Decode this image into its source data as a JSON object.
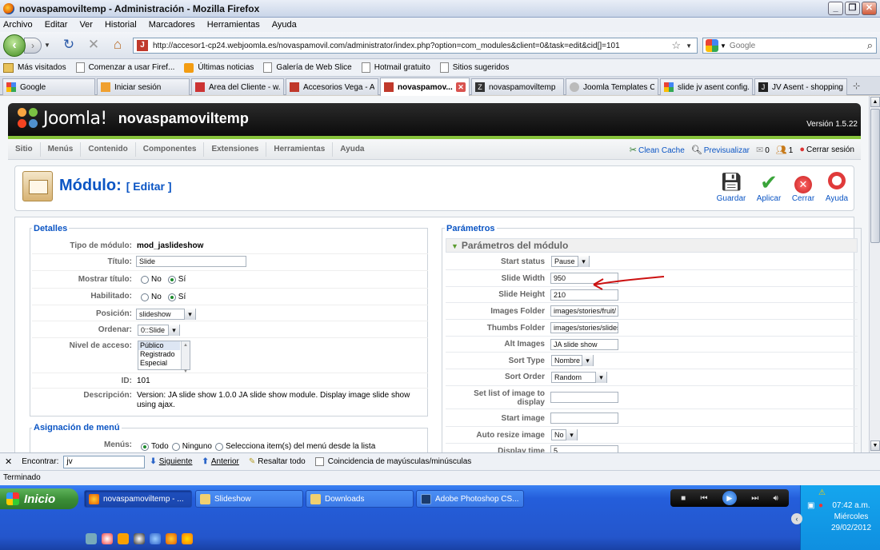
{
  "window": {
    "title": "novaspamoviltemp - Administración - Mozilla Firefox"
  },
  "menubar": [
    "Archivo",
    "Editar",
    "Ver",
    "Historial",
    "Marcadores",
    "Herramientas",
    "Ayuda"
  ],
  "url": "http://accesor1-cp24.webjoomla.es/novaspamovil.com/administrator/index.php?option=com_modules&client=0&task=edit&cid[]=101",
  "search_placeholder": "Google",
  "bookmarks": [
    "Más visitados",
    "Comenzar a usar Firef...",
    "Últimas noticias",
    "Galería de Web Slice",
    "Hotmail gratuito",
    "Sitios sugeridos"
  ],
  "tabs": [
    "Google",
    "Iniciar sesión",
    "Área del Cliente - w...",
    "Accesorios Vega - A...",
    "novaspamov...",
    "novaspamoviltemp",
    "Joomla Templates C...",
    "slide jv asent config...",
    "JV Asent - shopping..."
  ],
  "joomla": {
    "brand": "Joomla!",
    "site": "novaspamoviltemp",
    "version": "Versión 1.5.22",
    "menu": [
      "Sitio",
      "Menús",
      "Contenido",
      "Componentes",
      "Extensiones",
      "Herramientas",
      "Ayuda"
    ],
    "status": {
      "clean_cache": "Clean Cache",
      "preview": "Previsualizar",
      "messages": "0",
      "users": "1",
      "logout": "Cerrar sesión"
    },
    "page_title": "Módulo:",
    "page_subtitle": "[ Editar ]",
    "toolbar": {
      "save": "Guardar",
      "apply": "Aplicar",
      "close": "Cerrar",
      "help": "Ayuda"
    }
  },
  "details": {
    "legend": "Detalles",
    "type_label": "Tipo de módulo:",
    "type_value": "mod_jaslideshow",
    "title_label": "Título:",
    "title_value": "Slide",
    "show_title_label": "Mostrar título:",
    "enabled_label": "Habilitado:",
    "no": "No",
    "yes": "Sí",
    "position_label": "Posición:",
    "position_value": "slideshow",
    "order_label": "Ordenar:",
    "order_value": "0::Slide",
    "access_label": "Nivel de acceso:",
    "access_options": [
      "Público",
      "Registrado",
      "Especial"
    ],
    "id_label": "ID:",
    "id_value": "101",
    "desc_label": "Descripción:",
    "desc_value": "Version: JA slide show 1.0.0 JA slide show module. Display image slide show using ajax."
  },
  "menu_assign": {
    "legend": "Asignación de menú",
    "menus_label": "Menús:",
    "options": [
      "Todo",
      "Ninguno",
      "Selecciona item(s) del menú desde la lista"
    ]
  },
  "params": {
    "legend": "Parámetros",
    "section": "Parámetros del módulo",
    "rows": [
      {
        "label": "Start status",
        "value": "Pause"
      },
      {
        "label": "Slide Width",
        "value": "950"
      },
      {
        "label": "Slide Height",
        "value": "210"
      },
      {
        "label": "Images Folder",
        "value": "images/stories/fruit/"
      },
      {
        "label": "Thumbs Folder",
        "value": "images/stories/slides"
      },
      {
        "label": "Alt Images",
        "value": "JA slide show"
      },
      {
        "label": "Sort Type",
        "value": "Nombre"
      },
      {
        "label": "Sort Order",
        "value": "Random"
      },
      {
        "label": "Set list of image to display",
        "value": ""
      },
      {
        "label": "Start image",
        "value": ""
      },
      {
        "label": "Auto resize image",
        "value": "No"
      },
      {
        "label": "Display time",
        "value": "5"
      }
    ]
  },
  "findbar": {
    "label": "Encontrar:",
    "value": "jv",
    "next": "Siguiente",
    "prev": "Anterior",
    "highlight": "Resaltar todo",
    "match_case": "Coincidencia de mayúsculas/minúsculas"
  },
  "status": "Terminado",
  "taskbar": {
    "start": "Inicio",
    "tasks": [
      "novaspamoviltemp - ...",
      "Slideshow",
      "Downloads",
      "Adobe Photoshop CS..."
    ],
    "time": "07:42 a.m.",
    "day": "Miércoles",
    "date": "29/02/2012"
  },
  "colors": {
    "joomla_blue": "#0b55c4",
    "joomla_green": "#86c33a",
    "arrow": "#cc1111"
  }
}
